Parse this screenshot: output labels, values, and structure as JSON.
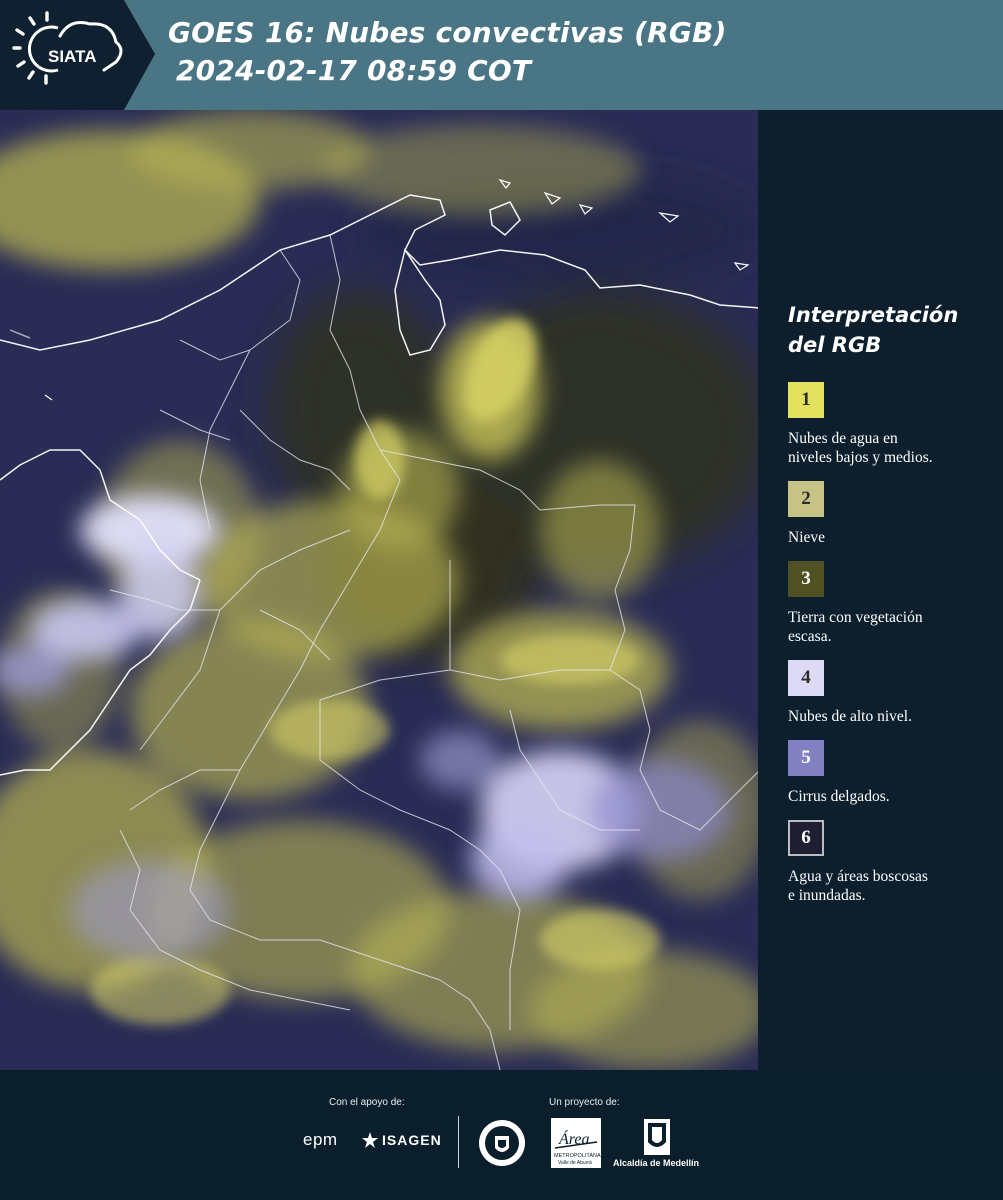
{
  "header": {
    "logo_text": "SIATA",
    "title_line1": "GOES 16: Nubes convectivas (RGB)",
    "title_line2": "2024-02-17 08:59 COT",
    "background_color": "#4a7585"
  },
  "map": {
    "icon": "satellite-map-image",
    "cloud_color": "#c9c45a",
    "background_color": "#2a2c56"
  },
  "legend": {
    "title_line1": "Interpretación",
    "title_line2": "del RGB",
    "items": [
      {
        "number": "1",
        "label_line1": "Nubes de agua en",
        "label_line2": "niveles bajos y medios.",
        "color": "#e2e05f"
      },
      {
        "number": "2",
        "label_line1": "Nieve",
        "label_line2": "",
        "color": "#c7c385"
      },
      {
        "number": "3",
        "label_line1": "Tierra con vegetación",
        "label_line2": "escasa.",
        "color": "#4f5122"
      },
      {
        "number": "4",
        "label_line1": "Nubes de alto nivel.",
        "label_line2": "",
        "color": "#dcdaf4"
      },
      {
        "number": "5",
        "label_line1": "Cirrus delgados.",
        "label_line2": "",
        "color": "#8380c1"
      },
      {
        "number": "6",
        "label_line1": "Agua y áreas boscosas",
        "label_line2": "e inundadas.",
        "color": "#1f1f34"
      }
    ]
  },
  "footer": {
    "support_label": "Con el apoyo de:",
    "project_label": "Un proyecto de:",
    "epm_text": "epm",
    "isagen_text": "ISAGEN",
    "area_text": "Área",
    "area_sub1": "METROPOLITANA",
    "area_sub2": "Valle de Aburrá",
    "alcaldia_text": "Alcaldía de Medellín"
  }
}
